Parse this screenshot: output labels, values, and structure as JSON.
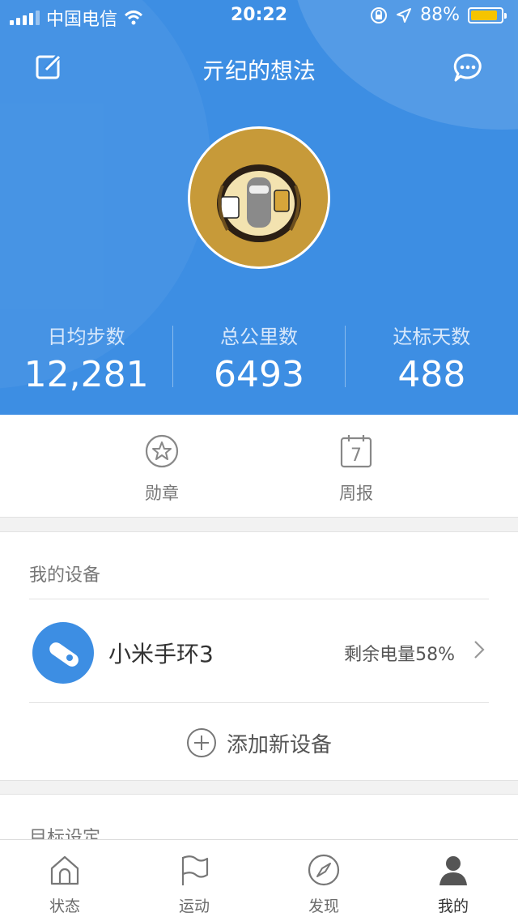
{
  "status_bar": {
    "carrier": "中国电信",
    "time": "20:22",
    "battery_percent": "88%",
    "battery_level": 0.88,
    "signal_icon": "signal-bars-icon",
    "wifi_icon": "wifi-icon",
    "rotation_lock_icon": "rotation-lock-icon",
    "location_icon": "location-arrow-icon"
  },
  "header": {
    "title": "亓纪的想法",
    "edit_icon": "edit-icon",
    "chat_icon": "chat-bubble-icon",
    "avatar_icon": "avatar-image",
    "background_color": "#3d8ee3"
  },
  "stats": [
    {
      "label": "日均步数",
      "value": "12,281"
    },
    {
      "label": "总公里数",
      "value": "6493"
    },
    {
      "label": "达标天数",
      "value": "488"
    }
  ],
  "quick_actions": [
    {
      "label": "勋章",
      "icon": "medal-star-icon"
    },
    {
      "label": "周报",
      "icon": "calendar-icon",
      "badge": "7"
    }
  ],
  "devices": {
    "section_title": "我的设备",
    "items": [
      {
        "name": "小米手环3",
        "battery": "剩余电量58%",
        "icon": "band-icon"
      }
    ],
    "add_label": "添加新设备",
    "add_icon": "plus-circle-icon"
  },
  "goals": {
    "section_title": "目标设定"
  },
  "tabbar": {
    "items": [
      {
        "label": "状态",
        "icon": "home-icon",
        "active": false
      },
      {
        "label": "运动",
        "icon": "flag-icon",
        "active": false
      },
      {
        "label": "发现",
        "icon": "compass-icon",
        "active": false
      },
      {
        "label": "我的",
        "icon": "profile-icon",
        "active": true
      }
    ]
  }
}
